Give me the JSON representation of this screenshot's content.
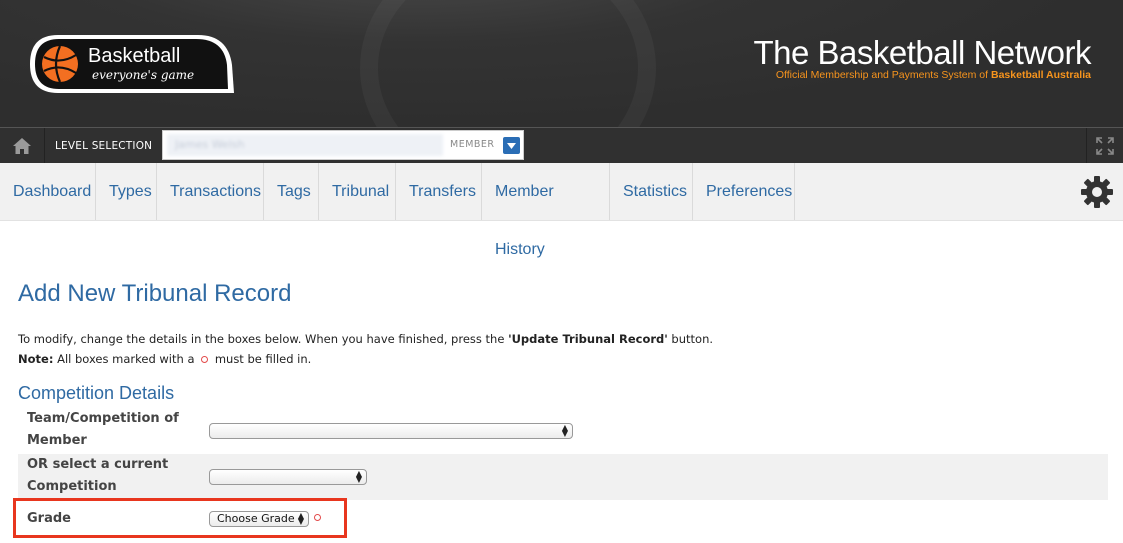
{
  "header": {
    "logo_main": "Basketball",
    "logo_tagline": "everyone's game",
    "title": "The Basketball Network",
    "subtitle_pre": "Official Membership and Payments System of ",
    "subtitle_bold": "Basketball Australia"
  },
  "levelbar": {
    "home_icon": "home-icon",
    "label": "LEVEL SELECTION",
    "selected_name": "James Welsh",
    "role": "MEMBER",
    "dropdown_icon": "chevron-down-icon",
    "expand_icon": "fullscreen-icon"
  },
  "nav": {
    "items": [
      "Dashboard",
      "Types",
      "Transactions",
      "Tags",
      "Tribunal",
      "Transfers",
      "Member History",
      "Statistics",
      "Preferences"
    ],
    "settings_icon": "gear-icon"
  },
  "page": {
    "title": "Add New Tribunal Record",
    "intro_pre": "To modify, change the details in the boxes below. When you have finished, press the ",
    "intro_bold": "'Update Tribunal Record'",
    "intro_post": " button.",
    "note_label": "Note:",
    "note_pre": " All boxes marked with a ",
    "note_post": " must be filled in."
  },
  "form": {
    "section_title": "Competition Details",
    "fields": [
      {
        "label_line1": "Team/Competition of",
        "label_line2": "Member",
        "value": "",
        "required": false
      },
      {
        "label_line1": "OR select a current",
        "label_line2": "Competition",
        "value": "",
        "required": false
      },
      {
        "label_line1": "Grade",
        "label_line2": "",
        "value": "Choose Grade",
        "required": true
      }
    ]
  },
  "colors": {
    "accent_blue": "#2f6aa3",
    "brand_orange": "#f7941d",
    "highlight_red": "#e8361e",
    "required_red": "#e34a4a"
  }
}
